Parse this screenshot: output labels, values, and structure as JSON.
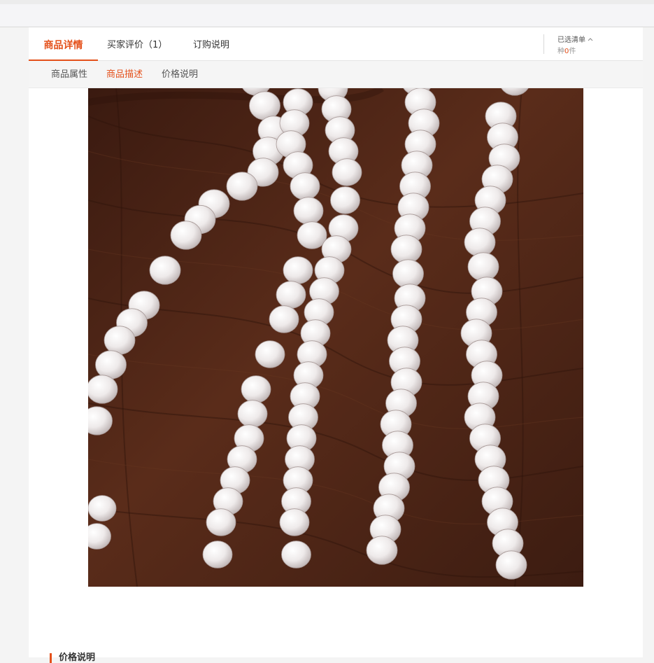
{
  "tabs": {
    "details": "商品详情",
    "reviews": "买家评价（1）",
    "ordering": "订购说明"
  },
  "cart": {
    "title": "已选清单",
    "count_prefix": "种",
    "count_value": "0",
    "count_suffix": "件"
  },
  "subtabs": {
    "attributes": "商品属性",
    "description": "商品描述",
    "price": "价格说明"
  },
  "section": {
    "price_heading": "价格说明"
  },
  "colors": {
    "accent": "#e4501a",
    "wood": "#4a2416",
    "pearl": "#f2efee"
  },
  "icons": {
    "cart_toggle": "chevron-up-icon"
  }
}
